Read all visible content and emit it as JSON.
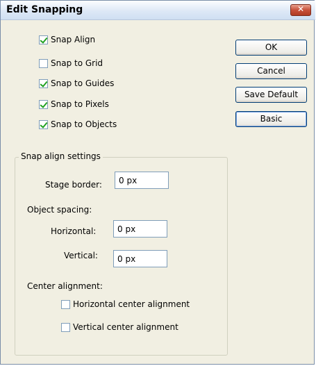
{
  "window": {
    "title": "Edit Snapping"
  },
  "checkboxes": [
    {
      "label": "Snap Align",
      "checked": true
    },
    {
      "label": "Snap to Grid",
      "checked": false
    },
    {
      "label": "Snap to Guides",
      "checked": true
    },
    {
      "label": "Snap to Pixels",
      "checked": true
    },
    {
      "label": "Snap to Objects",
      "checked": true
    }
  ],
  "buttons": {
    "ok": "OK",
    "cancel": "Cancel",
    "save_default": "Save Default",
    "basic": "Basic"
  },
  "snap_align": {
    "group_title": "Snap align settings",
    "stage_border_label": "Stage border:",
    "stage_border_value": "0 px",
    "object_spacing_label": "Object spacing:",
    "horizontal_label": "Horizontal:",
    "horizontal_value": "0 px",
    "vertical_label": "Vertical:",
    "vertical_value": "0 px",
    "center_alignment_label": "Center alignment:",
    "horizontal_center": {
      "label": "Horizontal center alignment",
      "checked": false
    },
    "vertical_center": {
      "label": "Vertical center alignment",
      "checked": false
    }
  }
}
